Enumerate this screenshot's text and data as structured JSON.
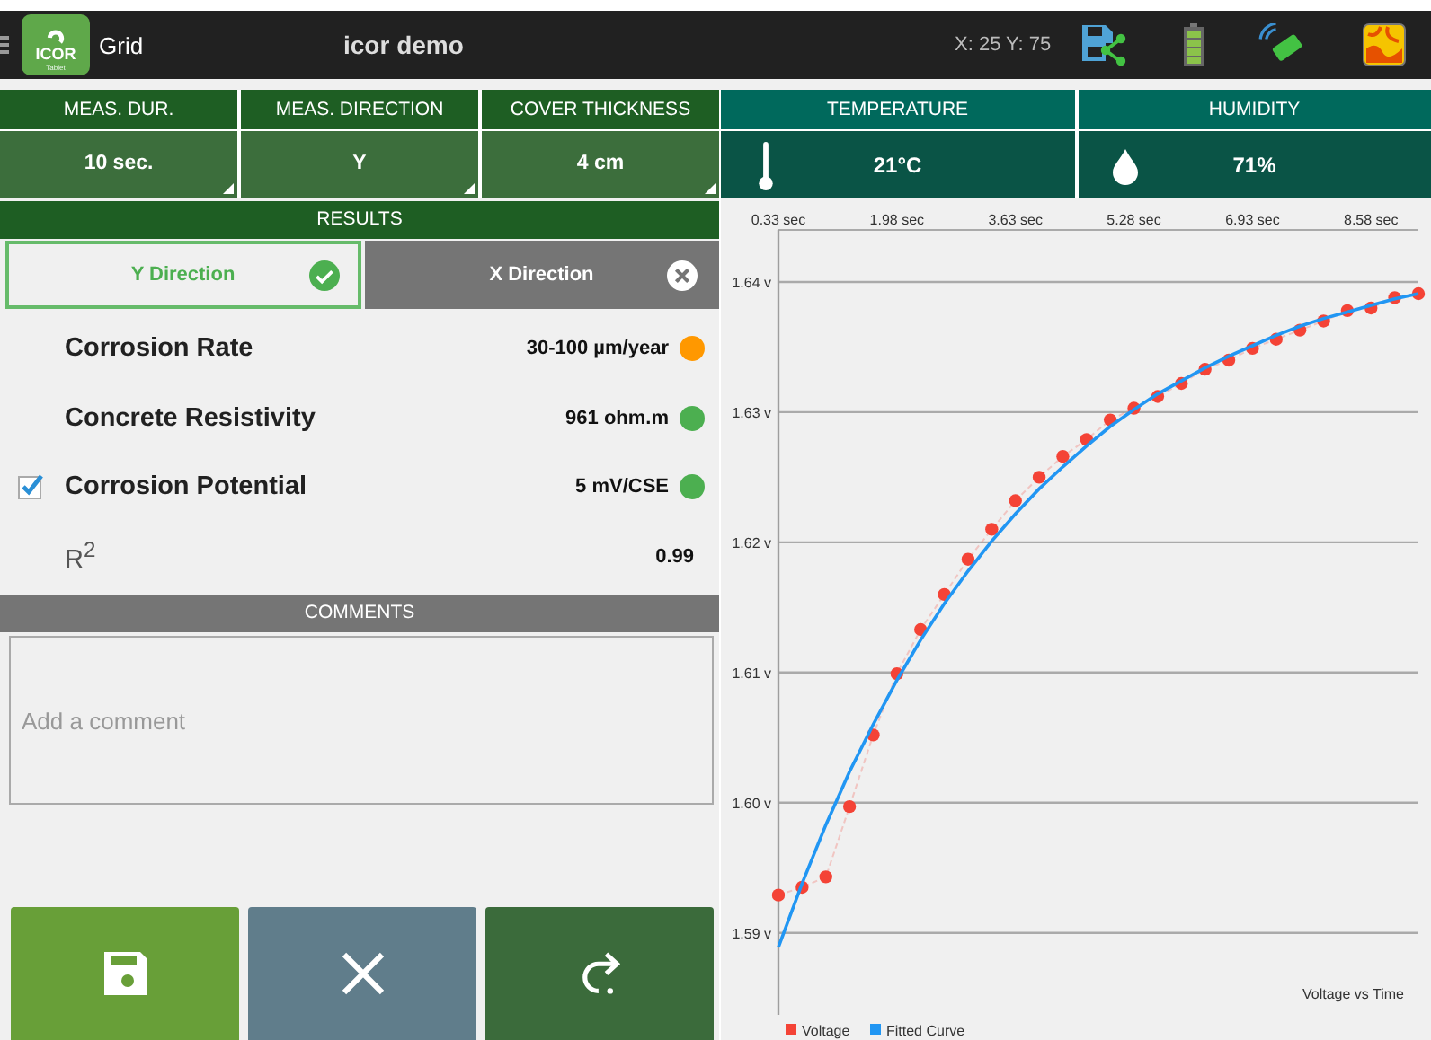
{
  "app_bar": {
    "logo": {
      "text": "ICOR",
      "subtext": "Tablet"
    },
    "mode": "Grid",
    "title": "icor demo",
    "coordinates": "X: 25 Y: 75"
  },
  "settings": [
    {
      "label": "MEAS. DUR.",
      "value": "10 sec."
    },
    {
      "label": "MEAS. DIRECTION",
      "value": "Y"
    },
    {
      "label": "COVER THICKNESS",
      "value": "4 cm"
    }
  ],
  "conditions": [
    {
      "kind": "temperature",
      "label": "TEMPERATURE",
      "value": "21°C"
    },
    {
      "kind": "humidity",
      "label": "HUMIDITY",
      "value": "71%"
    }
  ],
  "results": {
    "title": "RESULTS",
    "tabs": [
      {
        "label": "Y Direction",
        "selected": true
      },
      {
        "label": "X Direction",
        "selected": false
      }
    ],
    "rows": [
      {
        "kind": "metric",
        "label": "Corrosion Rate",
        "value": "30-100 µm/year",
        "color": "#ff9800"
      },
      {
        "kind": "metric",
        "label": "Concrete Resistivity",
        "value": "961 ohm.m",
        "color": "#4caf50"
      },
      {
        "kind": "checkbox",
        "label": "Corrosion Potential",
        "value": "5 mV/CSE",
        "color": "#4caf50",
        "checked": true
      },
      {
        "kind": "stat",
        "label": "R$^{2}$",
        "value": "0.99"
      }
    ]
  },
  "comments": {
    "title": "COMMENTS",
    "placeholder": "Add a comment"
  },
  "chart_data": {
    "type": "line",
    "title": "Voltage vs Time",
    "grid": true,
    "legend": true,
    "x": [
      0.33,
      0.66,
      0.99,
      1.32,
      1.65,
      1.98,
      2.31,
      2.64,
      2.97,
      3.3,
      3.63,
      3.96,
      4.29,
      4.62,
      4.95,
      5.28,
      5.61,
      5.94,
      6.27,
      6.6,
      6.93,
      7.26,
      7.59,
      7.92,
      8.25,
      8.58,
      8.91,
      9.24
    ],
    "series": [
      {
        "name": "Voltage",
        "color": "#f44336",
        "line_style": "dashed",
        "marker": "circle",
        "values": [
          1.5929,
          1.5935,
          1.5943,
          1.5997,
          1.6052,
          1.6099,
          1.6133,
          1.616,
          1.6187,
          1.621,
          1.6232,
          1.625,
          1.6266,
          1.6279,
          1.6294,
          1.6303,
          1.6312,
          1.6322,
          1.6333,
          1.634,
          1.6349,
          1.6356,
          1.6363,
          1.637,
          1.6378,
          1.638,
          1.6388,
          1.6391
        ]
      },
      {
        "name": "Fitted Curve",
        "color": "#2196f3",
        "line_style": "solid",
        "values": [
          1.5889,
          1.5938,
          1.5983,
          1.6024,
          1.606,
          1.6094,
          1.6125,
          1.6153,
          1.6178,
          1.6201,
          1.6222,
          1.6241,
          1.6258,
          1.6274,
          1.6289,
          1.6302,
          1.6314,
          1.6324,
          1.6334,
          1.6343,
          1.6351,
          1.6359,
          1.6366,
          1.6372,
          1.6377,
          1.6382,
          1.6387,
          1.6391
        ]
      }
    ],
    "xlim": [
      0.33,
      9.24
    ],
    "ylim": [
      1.5837,
      1.644
    ],
    "xticks": [
      {
        "value": 0.33,
        "label": "0.33 sec"
      },
      {
        "value": 1.98,
        "label": "1.98 sec"
      },
      {
        "value": 3.63,
        "label": "3.63 sec"
      },
      {
        "value": 5.28,
        "label": "5.28 sec"
      },
      {
        "value": 6.93,
        "label": "6.93 sec"
      },
      {
        "value": 8.58,
        "label": "8.58 sec"
      }
    ],
    "yticks": [
      {
        "value": 1.59,
        "label": "1.59 v"
      },
      {
        "value": 1.6,
        "label": "1.60 v"
      },
      {
        "value": 1.61,
        "label": "1.61 v"
      },
      {
        "value": 1.62,
        "label": "1.62 v"
      },
      {
        "value": 1.63,
        "label": "1.63 v"
      },
      {
        "value": 1.64,
        "label": "1.64 v"
      }
    ]
  }
}
